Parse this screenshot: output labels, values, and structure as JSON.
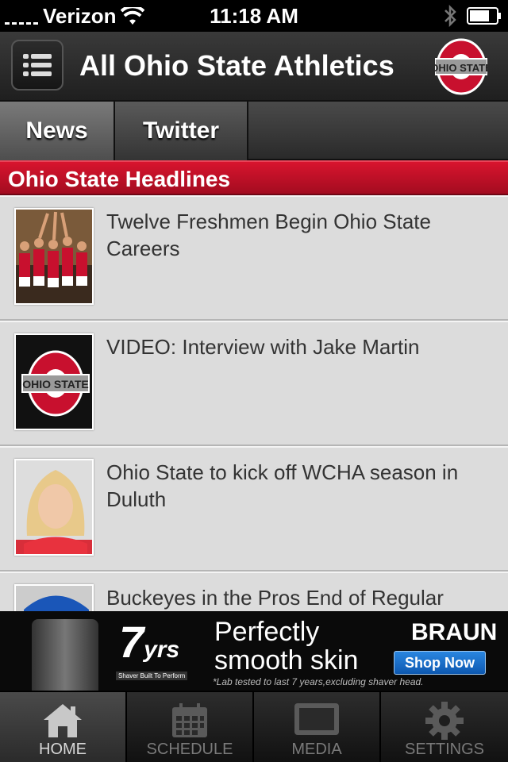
{
  "status_bar": {
    "carrier": "Verizon",
    "time": "11:18 AM"
  },
  "nav_bar": {
    "title": "All Ohio State Athletics",
    "logo_text": "OHIO STATE"
  },
  "segment_tabs": [
    {
      "label": "News",
      "active": true
    },
    {
      "label": "Twitter",
      "active": false
    },
    {
      "label": "",
      "active": false
    }
  ],
  "section_header": "Ohio State Headlines",
  "news_items": [
    {
      "headline": "Twelve Freshmen Begin Ohio State Careers",
      "thumb": "team-photo"
    },
    {
      "headline": "VIDEO: Interview with Jake Martin",
      "thumb": "ohio-state-logo"
    },
    {
      "headline": "Ohio State to kick off WCHA season in Duluth",
      "thumb": "portrait-blonde"
    },
    {
      "headline": "Buckeyes in the Pros End of Regular",
      "thumb": "player-blue-cap"
    }
  ],
  "ad": {
    "years": "7",
    "years_suffix": "yrs",
    "badge": "Shaver Built To Perform",
    "tagline_line1": "Perfectly",
    "tagline_line2": "smooth skin",
    "brand": "BRAUN",
    "cta": "Shop Now",
    "fine_print": "*Lab tested to last 7 years,excluding shaver head."
  },
  "tab_bar": [
    {
      "label": "HOME",
      "icon": "home-icon",
      "active": true
    },
    {
      "label": "SCHEDULE",
      "icon": "calendar-icon",
      "active": false
    },
    {
      "label": "MEDIA",
      "icon": "monitor-icon",
      "active": false
    },
    {
      "label": "SETTINGS",
      "icon": "gear-icon",
      "active": false
    }
  ],
  "colors": {
    "scarlet": "#c8102e",
    "gray": "#666666",
    "list_bg": "#dcdcdc"
  }
}
